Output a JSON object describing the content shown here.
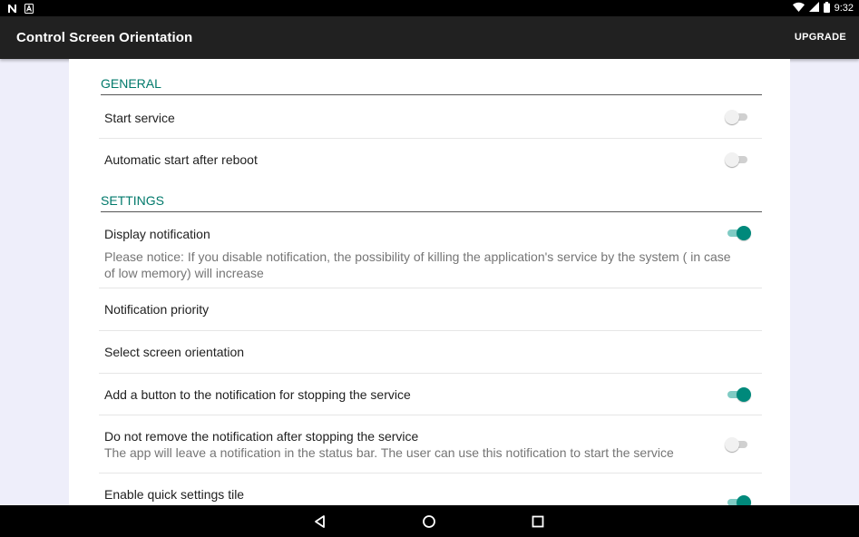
{
  "status_bar": {
    "time": "9:32",
    "left_icons": [
      "n-notification-icon",
      "a-notification-icon"
    ],
    "right_icons": [
      "wifi-icon",
      "signal-icon",
      "battery-icon"
    ]
  },
  "app_bar": {
    "title": "Control Screen Orientation",
    "upgrade_label": "UPGRADE"
  },
  "sections": [
    {
      "header": "GENERAL",
      "items": [
        {
          "title": "Start service",
          "switch": false
        },
        {
          "title": "Automatic start after reboot",
          "switch": false
        }
      ]
    },
    {
      "header": "SETTINGS",
      "items": [
        {
          "title": "Display notification",
          "summary": "Please notice: If you disable notification, the possibility of killing the application's service by the system ( in case of low memory) will increase",
          "switch": true
        },
        {
          "title": "Notification priority"
        },
        {
          "title": "Select screen orientation"
        },
        {
          "title": "Add a button to the notification for stopping the service",
          "switch": true
        },
        {
          "title": "Do not remove the notification after stopping the service",
          "summary": "The app will leave a notification in the status bar. The user can use this notification to start the service",
          "switch": false
        },
        {
          "title": "Enable quick settings tile",
          "switch": true
        }
      ]
    }
  ],
  "colors": {
    "accent": "#00897b",
    "section_header": "#00796b",
    "app_bar": "#212121",
    "page_background": "#eeeefa"
  },
  "nav_bar": [
    "back-icon",
    "home-icon",
    "recents-icon"
  ]
}
